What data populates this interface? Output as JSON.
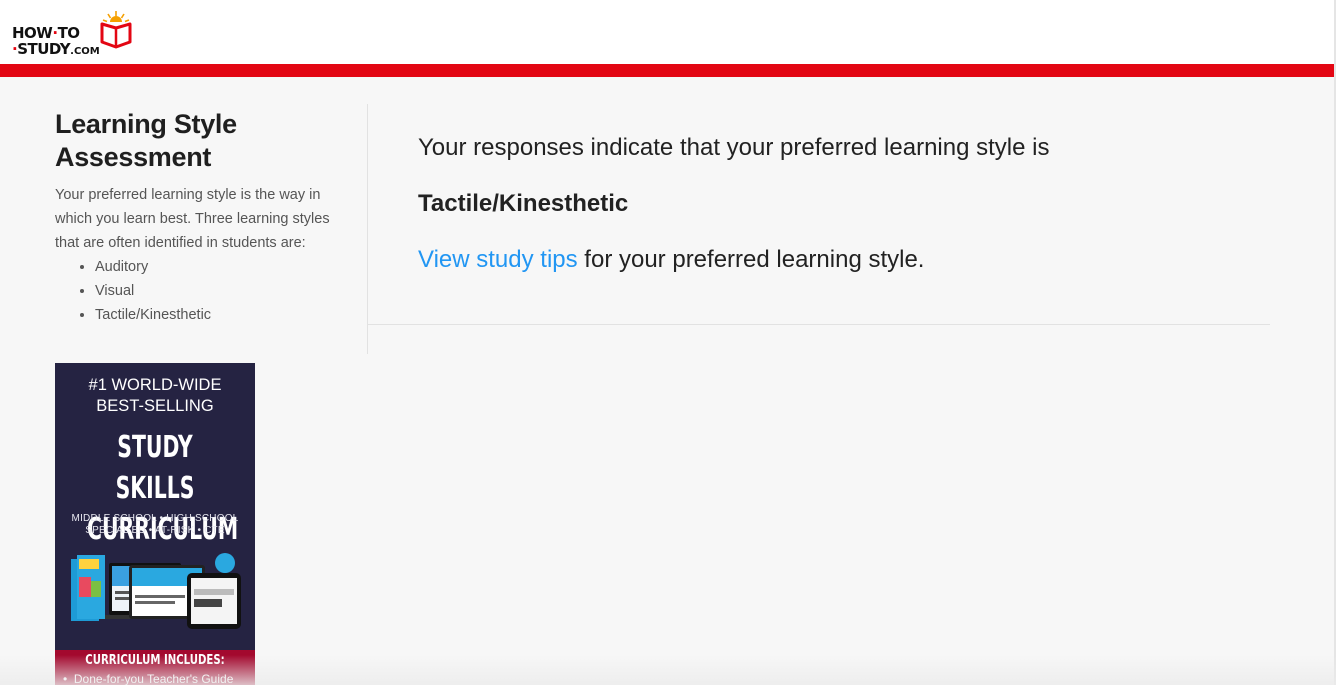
{
  "header": {
    "logo_line1": "HOW",
    "logo_line1b": "TO",
    "logo_line2": "STUDY",
    "logo_dotcom": ".COM",
    "accent_color": "#e30613"
  },
  "sidebar": {
    "title": "Learning Style Assessment",
    "description": "Your preferred learning style is the way in which you learn best. Three learning styles that are often identified in students are:",
    "styles": [
      "Auditory",
      "Visual",
      "Tactile/Kinesthetic"
    ]
  },
  "main": {
    "intro": "Your responses indicate that your preferred learning style is",
    "result": "Tactile/Kinesthetic",
    "tips_link": "View study tips",
    "tips_rest": " for your preferred learning style.",
    "link_color": "#2196f3"
  },
  "ad": {
    "line1": "#1 WORLD-WIDE",
    "line2": "BEST-SELLING",
    "big1": "STUDY SKILLS",
    "big2": "CURRICULUM",
    "small1": "MIDDLE SCHOOL • HIGH SCHOOL",
    "small2": "SPECIAL ED • AT-RISK • CTE",
    "band_title": "CURRICULUM INCLUDES:",
    "band_item": "Done-for-you Teacher's Guide",
    "background": "#252342",
    "band_color": "#a3092e"
  }
}
